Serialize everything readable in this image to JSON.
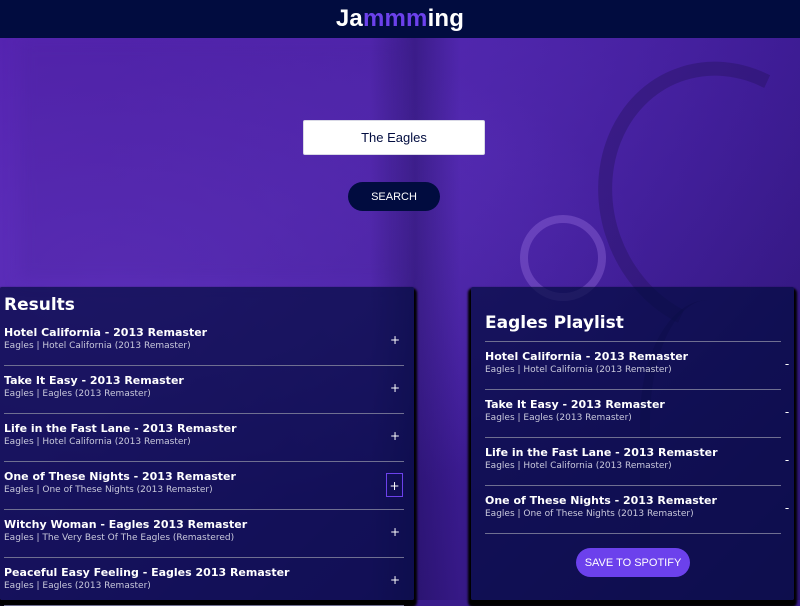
{
  "header": {
    "brand_start": "Ja",
    "brand_highlight": "mmm",
    "brand_end": "ing"
  },
  "search": {
    "value": "The Eagles",
    "button_label": "SEARCH"
  },
  "results": {
    "title": "Results",
    "action_symbol": "+",
    "tracks": [
      {
        "name": "Hotel California - 2013 Remaster",
        "info": "Eagles | Hotel California (2013 Remaster)"
      },
      {
        "name": "Take It Easy - 2013 Remaster",
        "info": "Eagles | Eagles (2013 Remaster)"
      },
      {
        "name": "Life in the Fast Lane - 2013 Remaster",
        "info": "Eagles | Hotel California (2013 Remaster)"
      },
      {
        "name": "One of These Nights - 2013 Remaster",
        "info": "Eagles | One of These Nights (2013 Remaster)"
      },
      {
        "name": "Witchy Woman - Eagles 2013 Remaster",
        "info": "Eagles | The Very Best Of The Eagles (Remastered)"
      },
      {
        "name": "Peaceful Easy Feeling - Eagles 2013 Remaster",
        "info": "Eagles | Eagles (2013 Remaster)"
      }
    ]
  },
  "playlist": {
    "name": "Eagles Playlist",
    "action_symbol": "-",
    "save_label": "SAVE TO SPOTIFY",
    "tracks": [
      {
        "name": "Hotel California - 2013 Remaster",
        "info": "Eagles | Hotel California (2013 Remaster)"
      },
      {
        "name": "Take It Easy - 2013 Remaster",
        "info": "Eagles | Eagles (2013 Remaster)"
      },
      {
        "name": "Life in the Fast Lane - 2013 Remaster",
        "info": "Eagles | Hotel California (2013 Remaster)"
      },
      {
        "name": "One of These Nights - 2013 Remaster",
        "info": "Eagles | One of These Nights (2013 Remaster)"
      }
    ]
  },
  "colors": {
    "navy": "#010c3f",
    "accent": "#6c41ec",
    "white": "#ffffff"
  }
}
